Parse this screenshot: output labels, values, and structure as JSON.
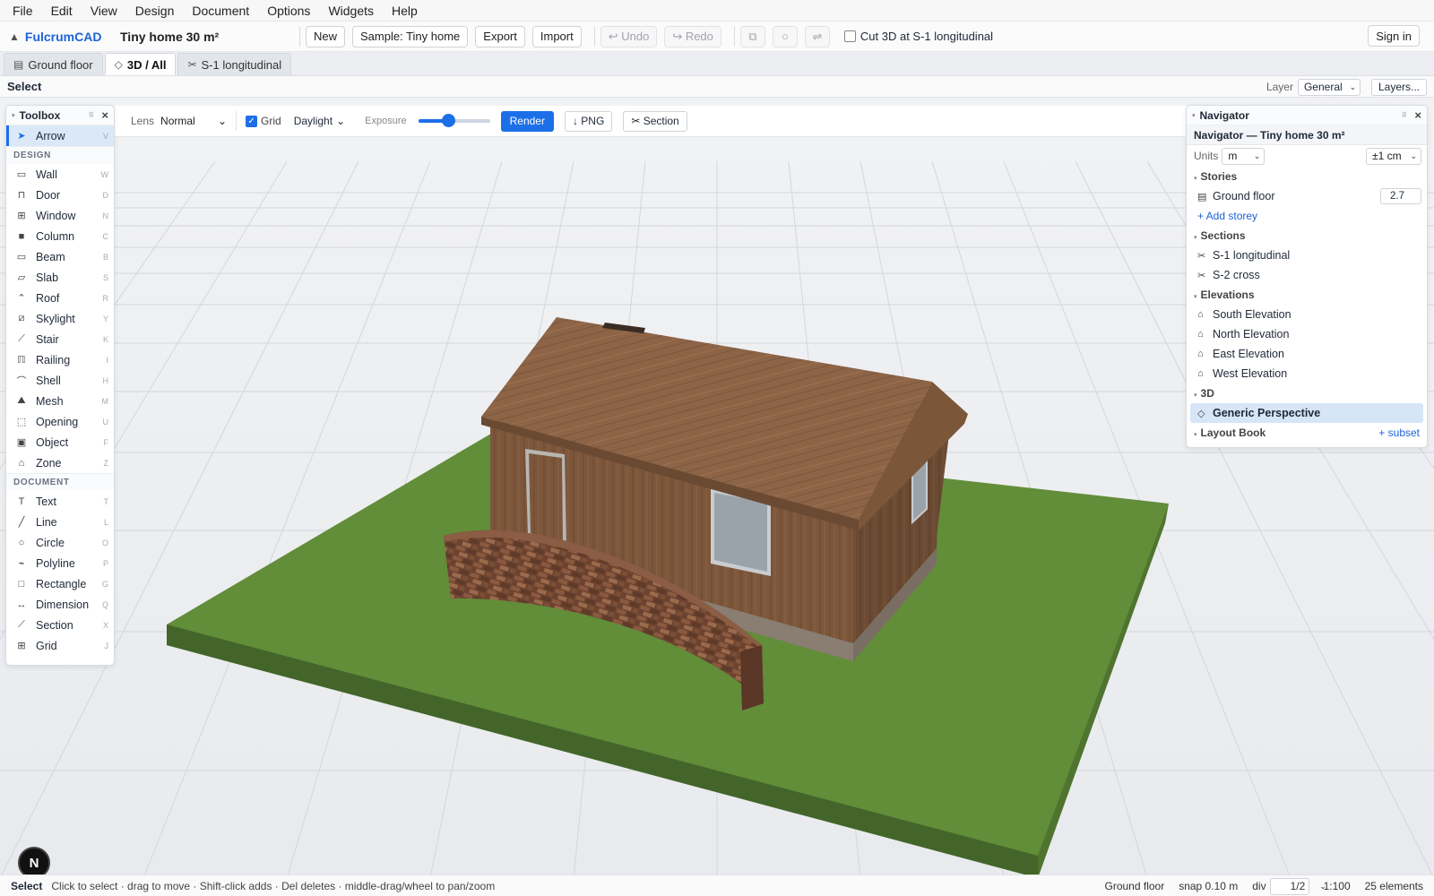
{
  "menu": [
    "File",
    "Edit",
    "View",
    "Design",
    "Document",
    "Options",
    "Widgets",
    "Help"
  ],
  "app": {
    "brand": "FulcrumCAD",
    "doc_title": "Tiny home 30 m²"
  },
  "toolbar": {
    "new": "New",
    "sample": "Sample: Tiny home",
    "export": "Export",
    "import": "Import",
    "undo": "↩ Undo",
    "redo": "↪ Redo",
    "cut_label": "Cut 3D at S-1 longitudinal",
    "signin": "Sign in"
  },
  "tabs": [
    {
      "label": "Ground floor",
      "icon": "stack-icon"
    },
    {
      "label": "3D / All",
      "icon": "diamond-icon",
      "active": true
    },
    {
      "label": "S-1 longitudinal",
      "icon": "scissors-icon"
    }
  ],
  "modebar": {
    "mode": "Select",
    "layer_label": "Layer",
    "layer_value": "General",
    "layers_button": "Layers..."
  },
  "render": {
    "lens_label": "Lens",
    "lens_value": "Normal",
    "grid_label": "Grid",
    "grid_checked": true,
    "light_value": "Daylight",
    "exposure_label": "Exposure",
    "exposure_fraction": 0.42,
    "render_button": "Render",
    "png_button": "↓ PNG",
    "section_button": "✂ Section"
  },
  "toolbox": {
    "title": "Toolbox",
    "arrow": {
      "label": "Arrow",
      "key": "V"
    },
    "design_label": "DESIGN",
    "design_tools": [
      {
        "label": "Wall",
        "key": "W",
        "icon": "wall-icon"
      },
      {
        "label": "Door",
        "key": "D",
        "icon": "door-icon"
      },
      {
        "label": "Window",
        "key": "N",
        "icon": "window-icon"
      },
      {
        "label": "Column",
        "key": "C",
        "icon": "column-icon"
      },
      {
        "label": "Beam",
        "key": "B",
        "icon": "beam-icon"
      },
      {
        "label": "Slab",
        "key": "S",
        "icon": "slab-icon"
      },
      {
        "label": "Roof",
        "key": "R",
        "icon": "roof-icon"
      },
      {
        "label": "Skylight",
        "key": "Y",
        "icon": "skylight-icon"
      },
      {
        "label": "Stair",
        "key": "K",
        "icon": "stair-icon"
      },
      {
        "label": "Railing",
        "key": "I",
        "icon": "railing-icon"
      },
      {
        "label": "Shell",
        "key": "H",
        "icon": "shell-icon"
      },
      {
        "label": "Mesh",
        "key": "M",
        "icon": "mesh-icon"
      },
      {
        "label": "Opening",
        "key": "U",
        "icon": "opening-icon"
      },
      {
        "label": "Object",
        "key": "F",
        "icon": "object-icon"
      },
      {
        "label": "Zone",
        "key": "Z",
        "icon": "zone-icon"
      }
    ],
    "document_label": "DOCUMENT",
    "document_tools": [
      {
        "label": "Text",
        "key": "T",
        "icon": "text-icon"
      },
      {
        "label": "Line",
        "key": "L",
        "icon": "line-icon"
      },
      {
        "label": "Circle",
        "key": "O",
        "icon": "circle-icon"
      },
      {
        "label": "Polyline",
        "key": "P",
        "icon": "polyline-icon"
      },
      {
        "label": "Rectangle",
        "key": "G",
        "icon": "rectangle-icon"
      },
      {
        "label": "Dimension",
        "key": "Q",
        "icon": "dimension-icon"
      },
      {
        "label": "Section",
        "key": "X",
        "icon": "section-icon"
      },
      {
        "label": "Grid",
        "key": "J",
        "icon": "grid-icon"
      }
    ]
  },
  "navigator": {
    "header": "Navigator",
    "title": "Navigator — Tiny home 30 m²",
    "units_label": "Units",
    "units_value": "m",
    "precision_value": "±1 cm",
    "stories_label": "Stories",
    "stories": [
      {
        "label": "Ground floor",
        "height": "2.7"
      }
    ],
    "add_storey": "+ Add storey",
    "sections_label": "Sections",
    "sections": [
      "S-1 longitudinal",
      "S-2 cross"
    ],
    "elevations_label": "Elevations",
    "elevations": [
      "South Elevation",
      "North Elevation",
      "East Elevation",
      "West Elevation"
    ],
    "threed_label": "3D",
    "threed": [
      "Generic Perspective"
    ],
    "layout_label": "Layout Book",
    "subset_link": "+ subset"
  },
  "avatar": {
    "initial": "N"
  },
  "status": {
    "mode": "Select",
    "hint": "Click to select · drag to move · Shift-click adds · Del deletes · middle-drag/wheel to pan/zoom",
    "storey": "Ground floor",
    "snap": "snap 0.10 m",
    "div_label": "div",
    "div_value": "1/2",
    "scale": "1:100",
    "elements": "25 elements"
  },
  "colors": {
    "accent": "#1d6fe8",
    "brand": "#1d63d8",
    "grass": "#5f8a36",
    "wood": "#8a6244",
    "brick": "#7a4a32"
  }
}
